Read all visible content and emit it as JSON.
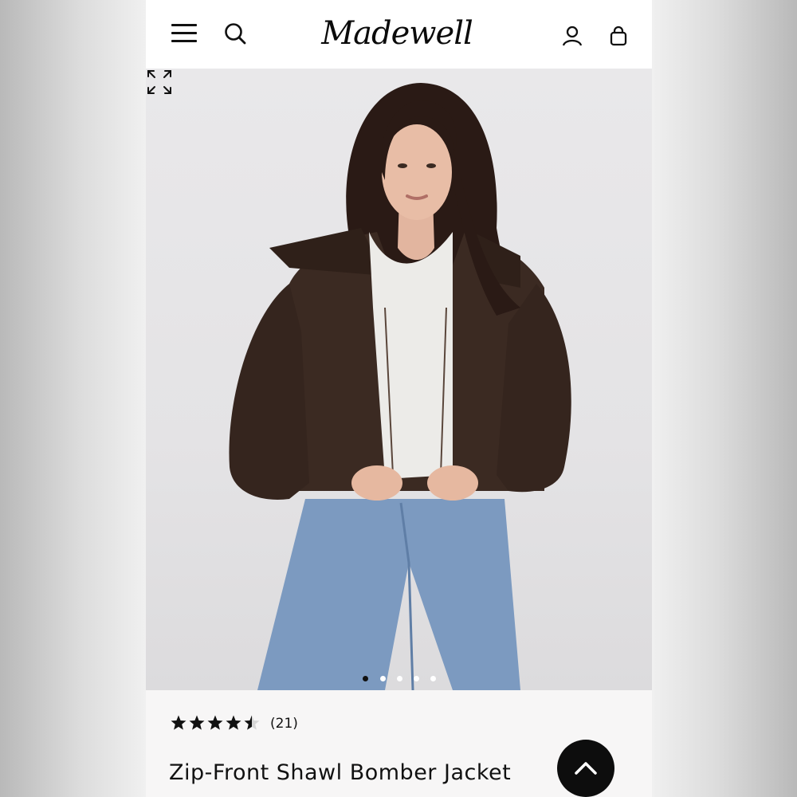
{
  "header": {
    "brand": "Madewell",
    "icons": [
      "menu-icon",
      "search-icon",
      "account-icon",
      "bag-icon"
    ]
  },
  "hero": {
    "image_subject": "Model wearing brown zip-front shawl bomber jacket, white tee and light-wash jeans",
    "carousel": {
      "total": 5,
      "active": 1
    }
  },
  "product": {
    "rating": 4.5,
    "rating_max": 5,
    "review_count": "(21)",
    "title": "Zip-Front Shawl Bomber Jacket"
  },
  "colors": {
    "jacket": "#3b2a22",
    "denim": "#7c9ac0",
    "background": "#e6e5e7"
  }
}
